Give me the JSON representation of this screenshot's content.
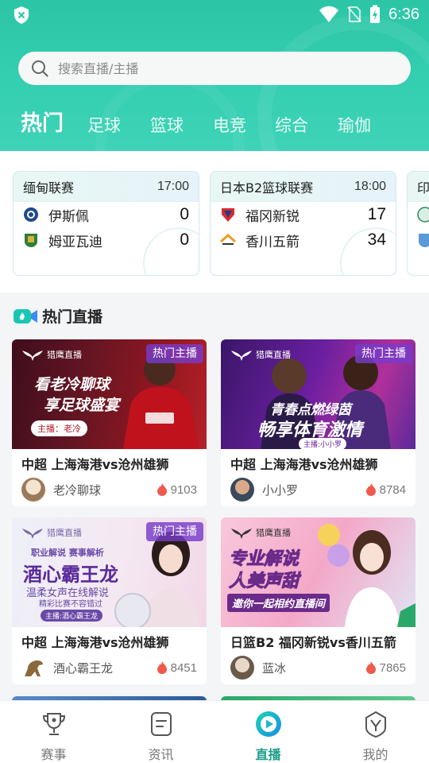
{
  "status_bar": {
    "time": "6:36"
  },
  "search": {
    "placeholder": "搜索直播/主播"
  },
  "tabs": [
    {
      "label": "热门",
      "active": true
    },
    {
      "label": "足球"
    },
    {
      "label": "篮球"
    },
    {
      "label": "电竞"
    },
    {
      "label": "综合"
    },
    {
      "label": "瑜伽"
    }
  ],
  "matches": [
    {
      "league": "缅甸联赛",
      "time": "17:00",
      "home": {
        "name": "伊斯佩",
        "score": "0"
      },
      "away": {
        "name": "姆亚瓦迪",
        "score": "0"
      }
    },
    {
      "league": "日本B2篮球联赛",
      "time": "18:00",
      "home": {
        "name": "福冈新锐",
        "score": "17"
      },
      "away": {
        "name": "香川五箭",
        "score": "34"
      }
    },
    {
      "league": "印"
    }
  ],
  "hot_live": {
    "title": "热门直播",
    "streams": [
      {
        "badge": "热门主播",
        "brand": "猎鹰直播",
        "line1": "看老冷聊球",
        "line2": "享足球盛宴",
        "host_tag": "主播：老冷",
        "title": "中超 上海海港vs沧州雄狮",
        "host": "老冷聊球",
        "heat": "9103"
      },
      {
        "badge": "热门主播",
        "brand": "猎鹰直播",
        "line1": "青春点燃绿茵",
        "line2": "畅享体育激情",
        "host_tag": "主播:小小罗",
        "title": "中超 上海海港vs沧州雄狮",
        "host": "小小罗",
        "heat": "8784"
      },
      {
        "badge": "热门主播",
        "brand": "猎鹰直播",
        "line1": "职业解说 赛事解析",
        "line2": "酒心霸王龙",
        "line3": "温柔女声在线解说",
        "line4": "精彩比赛不容错过",
        "host_tag": "主播:酒心霸王龙",
        "title": "中超 上海海港vs沧州雄狮",
        "host": "酒心霸王龙",
        "heat": "8451"
      },
      {
        "brand": "猎鹰直播",
        "line1": "专业解说",
        "line2": "人美声甜",
        "line3": "邀你一起相约直播间",
        "title": "日篮B2 福冈新锐vs香川五箭",
        "host": "蓝冰",
        "heat": "7865"
      }
    ]
  },
  "bottom_nav": [
    {
      "label": "赛事",
      "icon": "trophy-icon"
    },
    {
      "label": "资讯",
      "icon": "news-icon"
    },
    {
      "label": "直播",
      "icon": "live-play-icon",
      "active": true
    },
    {
      "label": "我的",
      "icon": "profile-icon"
    }
  ],
  "colors": {
    "brand": "#2cc6a6",
    "active_nav": "#1f9e8a",
    "badge": "#7a3cc8",
    "heat": "#f05a4a"
  }
}
